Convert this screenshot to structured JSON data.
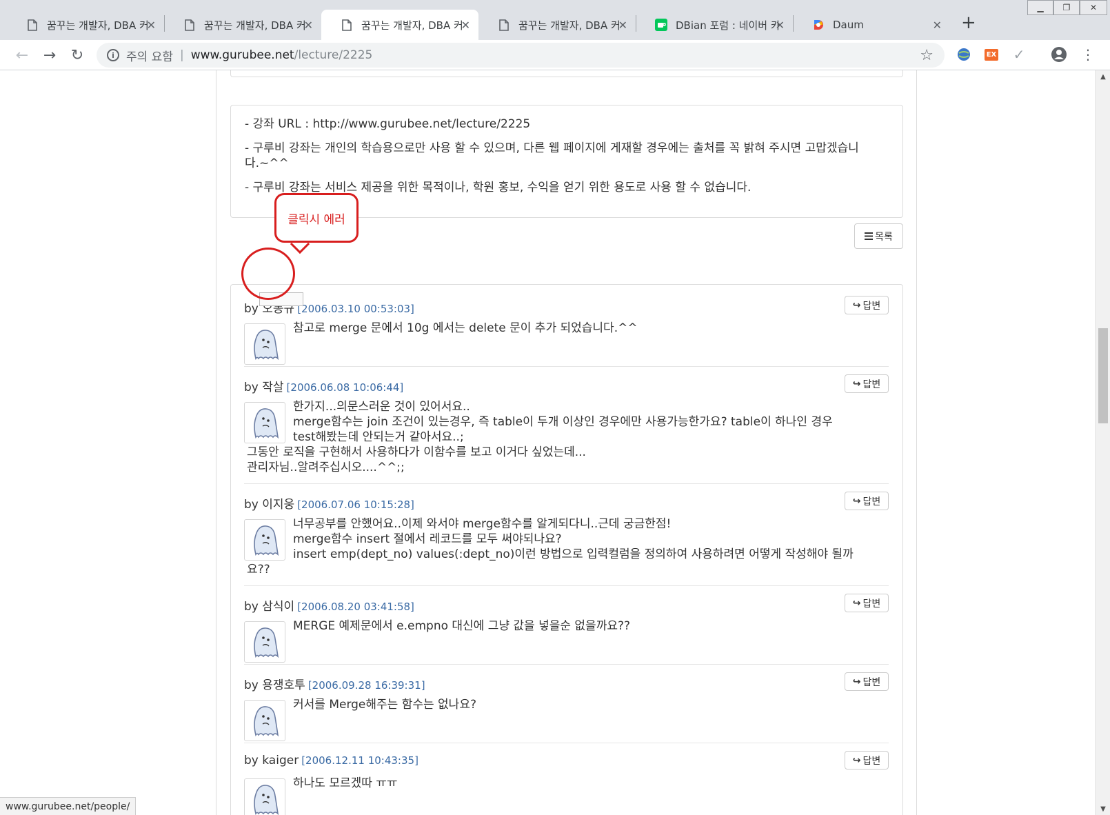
{
  "browser": {
    "tabs": [
      {
        "title": "꿈꾸는 개발자, DBA 커",
        "icon": "page-icon",
        "active": false
      },
      {
        "title": "꿈꾸는 개발자, DBA 커",
        "icon": "page-icon",
        "active": false
      },
      {
        "title": "꿈꾸는 개발자, DBA 커",
        "icon": "page-icon",
        "active": true
      },
      {
        "title": "꿈꾸는 개발자, DBA 커",
        "icon": "page-icon",
        "active": false
      },
      {
        "title": "DBian 포럼 : 네이버 카",
        "icon": "naver-cafe-icon",
        "active": false
      },
      {
        "title": "Daum",
        "icon": "daum-icon",
        "active": false
      }
    ],
    "close_glyph": "✕",
    "new_tab_glyph": "+",
    "address": {
      "security_label": "주의 요함",
      "separator": "|",
      "host": "www.gurubee.net",
      "path": "/lecture/2225"
    },
    "ext_badge": "EX",
    "status_url": "www.gurubee.net/people/"
  },
  "notice": {
    "lines": [
      "- 강좌 URL : http://www.gurubee.net/lecture/2225",
      "- 구루비 강좌는 개인의 학습용으로만 사용 할 수 있으며, 다른 웹 페이지에 게재할 경우에는 출처를 꼭 밝혀 주시면 고맙겠습니다.~^^",
      "- 구루비 강좌는 서비스 제공을 위한 목적이나, 학원 홍보, 수익을 얻기 위한 용도로 사용 할 수 없습니다."
    ]
  },
  "list_button": "목록",
  "annotation": {
    "callout_text": "클릭시 에러"
  },
  "comments": [
    {
      "author": "오동규",
      "date": "[2006.03.10 00:53:03]",
      "reply_label": "답변",
      "lines": [
        "참고로 merge 문에서 10g 에서는 delete 문이 추가 되었습니다.^^"
      ]
    },
    {
      "author": "작살",
      "date": "[2006.06.08 10:06:44]",
      "reply_label": "답변",
      "lines": [
        "한가지...의문스러운 것이 있어서요..",
        "merge함수는 join 조건이 있는경우, 즉 table이 두개 이상인 경우에만 사용가능한가요? table이 하나인 경우",
        "test해봤는데 안되는거 같아서요..;",
        "그동안 로직을 구현해서 사용하다가 이함수를 보고 이거다 싶었는데...",
        "관리자님..알려주십시오....^^;;"
      ]
    },
    {
      "author": "이지웅",
      "date": "[2006.07.06 10:15:28]",
      "reply_label": "답변",
      "lines": [
        "너무공부를 안했어요..이제 와서야 merge함수를 알게되다니..근데 궁금한점!",
        "merge함수 insert 절에서 레코드를 모두 써야되나요?",
        "insert emp(dept_no) values(:dept_no)이런 방법으로 입력컬럼을 정의하여 사용하려면 어떻게 작성해야 될까",
        "요??"
      ]
    },
    {
      "author": "삼식이",
      "date": "[2006.08.20 03:41:58]",
      "reply_label": "답변",
      "lines": [
        "MERGE 예제문에서 e.empno 대신에 그냥 값을 넣을순 없을까요??"
      ]
    },
    {
      "author": "용쟁호투",
      "date": "[2006.09.28 16:39:31]",
      "reply_label": "답변",
      "lines": [
        "커서를 Merge해주는 함수는 없나요?"
      ]
    },
    {
      "author": "kaiger",
      "date": "[2006.12.11 10:43:35]",
      "reply_label": "답변",
      "lines": [
        "하나도 모르겠따 ㅠㅠ"
      ]
    }
  ],
  "by_label": "by"
}
